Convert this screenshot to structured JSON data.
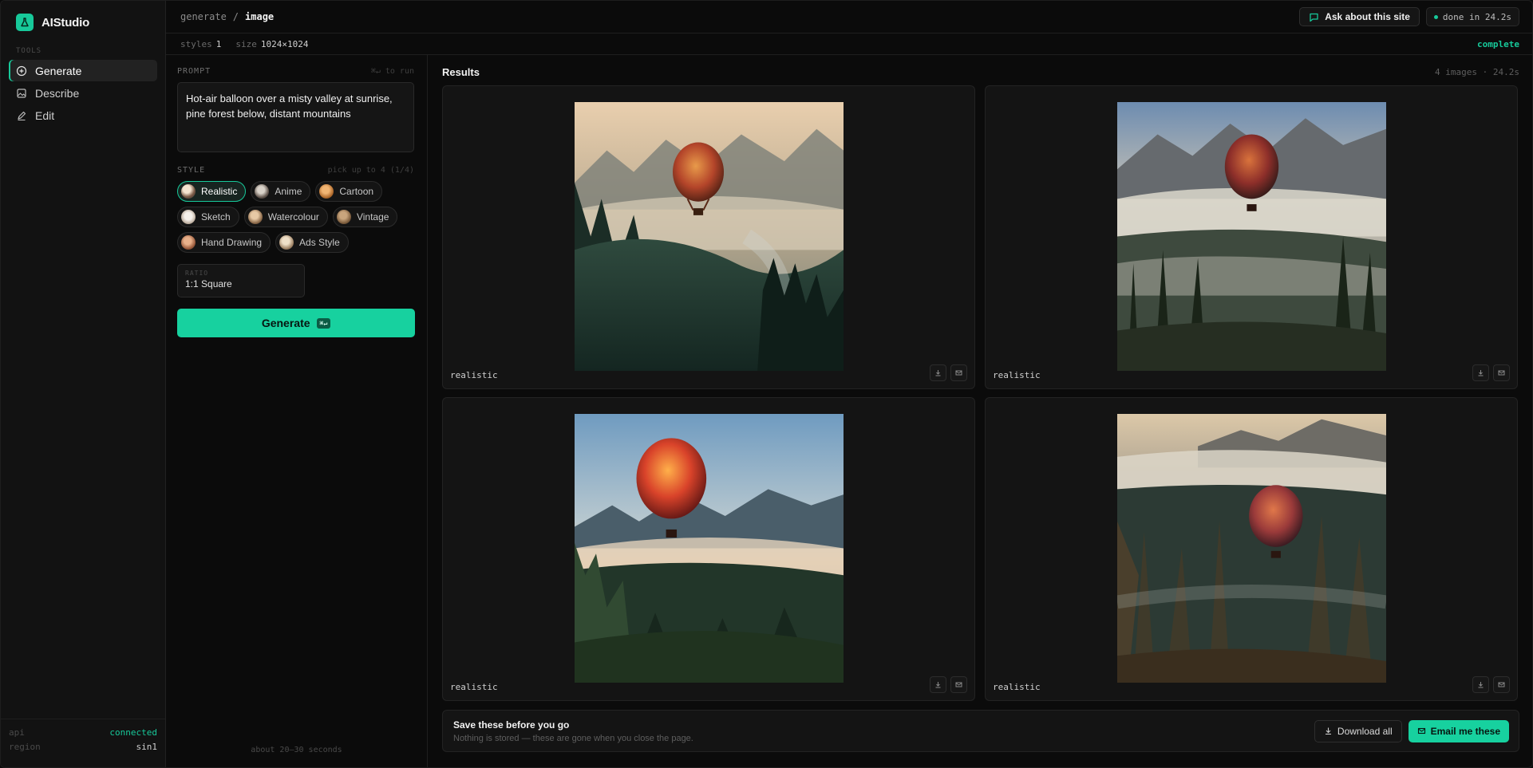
{
  "brand": {
    "name": "AIStudio"
  },
  "sidebar": {
    "section_label": "TOOLS",
    "items": [
      {
        "label": "Generate",
        "icon": "plus-circle-icon",
        "active": true
      },
      {
        "label": "Describe",
        "icon": "image-icon",
        "active": false
      },
      {
        "label": "Edit",
        "icon": "pencil-icon",
        "active": false
      }
    ],
    "status": [
      {
        "key": "api",
        "value": "connected"
      },
      {
        "key": "region",
        "value": "sin1"
      }
    ]
  },
  "topbar": {
    "breadcrumb": [
      "generate",
      "/",
      "image"
    ],
    "ask_label": "Ask about this site",
    "done_label": "done in 24.2s"
  },
  "subbar": {
    "styles_key": "styles",
    "styles_val": "1",
    "size_key": "size",
    "size_val": "1024×1024",
    "status": "complete"
  },
  "panel": {
    "prompt_label": "PROMPT",
    "prompt_hint": "⌘↵ to run",
    "prompt_value": "Hot-air balloon over a misty valley at sunrise, pine forest below, distant mountains",
    "style_label": "STYLE",
    "style_hint": "pick up to 4 (1/4)",
    "styles": [
      {
        "label": "Realistic",
        "active": true
      },
      {
        "label": "Anime",
        "active": false
      },
      {
        "label": "Cartoon",
        "active": false
      },
      {
        "label": "Sketch",
        "active": false
      },
      {
        "label": "Watercolour",
        "active": false
      },
      {
        "label": "Vintage",
        "active": false
      },
      {
        "label": "Hand Drawing",
        "active": false
      },
      {
        "label": "Ads Style",
        "active": false
      }
    ],
    "ratio_label": "RATIO",
    "ratio_value": "1:1 Square",
    "generate_label": "Generate",
    "generate_kbd": "⌘↵",
    "footer_note": "about 20–30 seconds"
  },
  "results": {
    "title": "Results",
    "meta": "4 images · 24.2s",
    "cards": [
      {
        "label": "realistic",
        "download_icon": "download-icon",
        "email_icon": "mail-icon"
      },
      {
        "label": "realistic",
        "download_icon": "download-icon",
        "email_icon": "mail-icon"
      },
      {
        "label": "realistic",
        "download_icon": "download-icon",
        "email_icon": "mail-icon"
      },
      {
        "label": "realistic",
        "download_icon": "download-icon",
        "email_icon": "mail-icon"
      }
    ],
    "save_title": "Save these before you go",
    "save_sub": "Nothing is stored — these are gone when you close the page.",
    "download_all_label": "Download all",
    "email_label": "Email me these"
  },
  "colors": {
    "accent": "#17d19f",
    "bg": "#0b0b0b",
    "panel": "#121212"
  }
}
